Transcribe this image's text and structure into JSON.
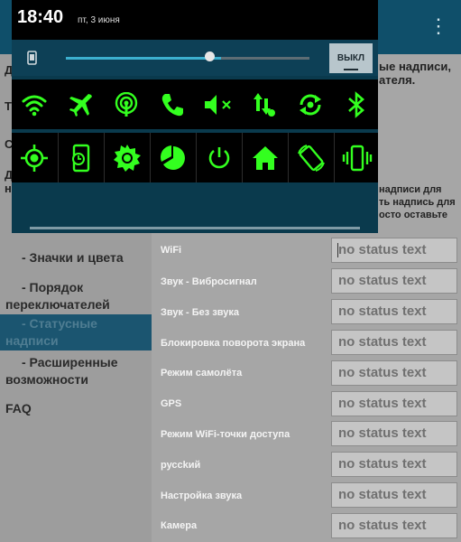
{
  "statusbar": {
    "time": "18:40",
    "date": "пт, 3 июня"
  },
  "brightness": {
    "level_percent": 67,
    "toggle_label": "ВЫКЛ"
  },
  "tiles_row1": [
    "wifi-icon",
    "airplane-icon",
    "hotspot-icon",
    "phone-icon",
    "sound-off-icon",
    "data-icon",
    "sync-icon",
    "bluetooth-icon"
  ],
  "tiles_row2": [
    "gps-icon",
    "screen-timeout-icon",
    "brightness-icon",
    "battery-icon",
    "power-icon",
    "home-icon",
    "rotate-icon",
    "vibrate-icon"
  ],
  "accent": "#33ff1f",
  "background_text": {
    "top_right_1": "ые надписи,",
    "top_right_2": "ателя.",
    "mid_right_1": "надписи для",
    "mid_right_2": "ть надпись для",
    "mid_right_3": "осто оставьте"
  },
  "sidebar": {
    "items": [
      {
        "label": "- Значки и цвета"
      },
      {
        "label": "- Порядок переключателей"
      },
      {
        "label": "- Статусные надписи"
      },
      {
        "label": "- Расширенные возможности"
      },
      {
        "label": "FAQ"
      }
    ]
  },
  "rows": [
    {
      "label": "WiFi",
      "value": "no status text"
    },
    {
      "label": "Звук - Вибросигнал",
      "value": "no status text"
    },
    {
      "label": "Звук - Без звука",
      "value": "no status text"
    },
    {
      "label": "Блокировка поворота экрана",
      "value": "no status text"
    },
    {
      "label": "Режим самолёта",
      "value": "no status text"
    },
    {
      "label": "GPS",
      "value": "no status text"
    },
    {
      "label": "Режим WiFi-точки доступа",
      "value": "no status text"
    },
    {
      "label": "руссkий",
      "value": "no status text"
    },
    {
      "label": "Настройка звука",
      "value": "no status text"
    },
    {
      "label": "Камера",
      "value": "no status text"
    }
  ]
}
